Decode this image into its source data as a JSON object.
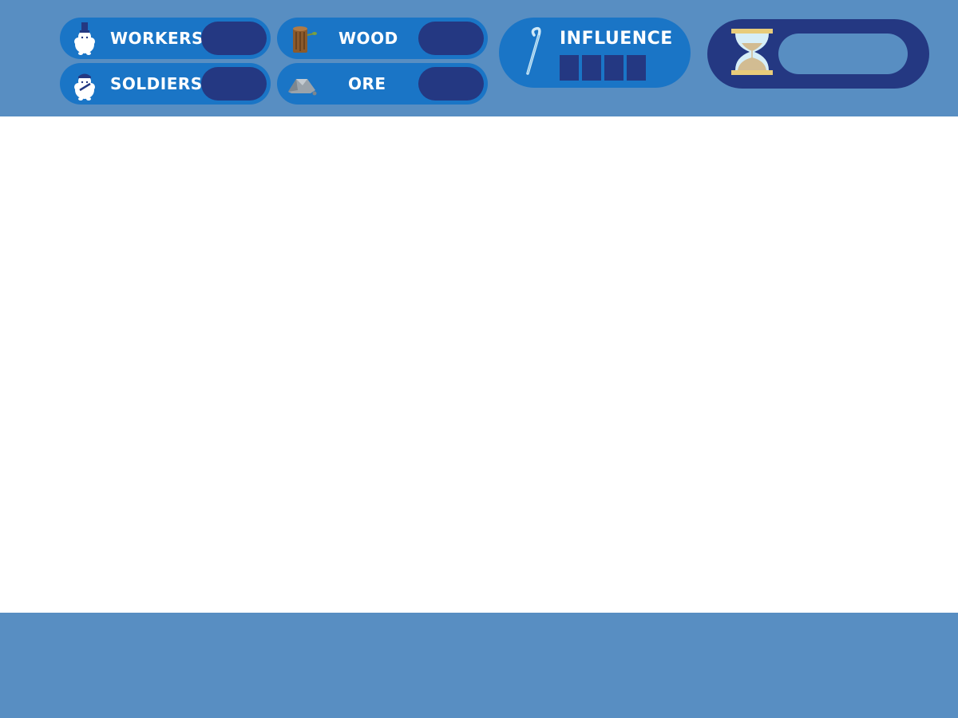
{
  "resources": {
    "workers": {
      "label": "WORKERS",
      "value": "",
      "icon": "worker-sheep-icon"
    },
    "soldiers": {
      "label": "SOLDIERS",
      "value": "",
      "icon": "soldier-sheep-icon"
    },
    "wood": {
      "label": "WOOD",
      "value": "",
      "icon": "wood-log-icon"
    },
    "ore": {
      "label": "ORE",
      "value": "",
      "icon": "ore-rock-icon"
    }
  },
  "influence": {
    "label": "INFLUENCE",
    "slots": 4,
    "icon": "shepherd-staff-icon"
  },
  "timer": {
    "value": "",
    "icon": "hourglass-icon"
  },
  "colors": {
    "bar_background": "#588ec2",
    "pill": "#1a75c6",
    "value_box": "#243882",
    "hourglass_frame": "#e8cc7a",
    "hourglass_sand": "#d2bc92",
    "hourglass_glass": "#d6eef8"
  }
}
